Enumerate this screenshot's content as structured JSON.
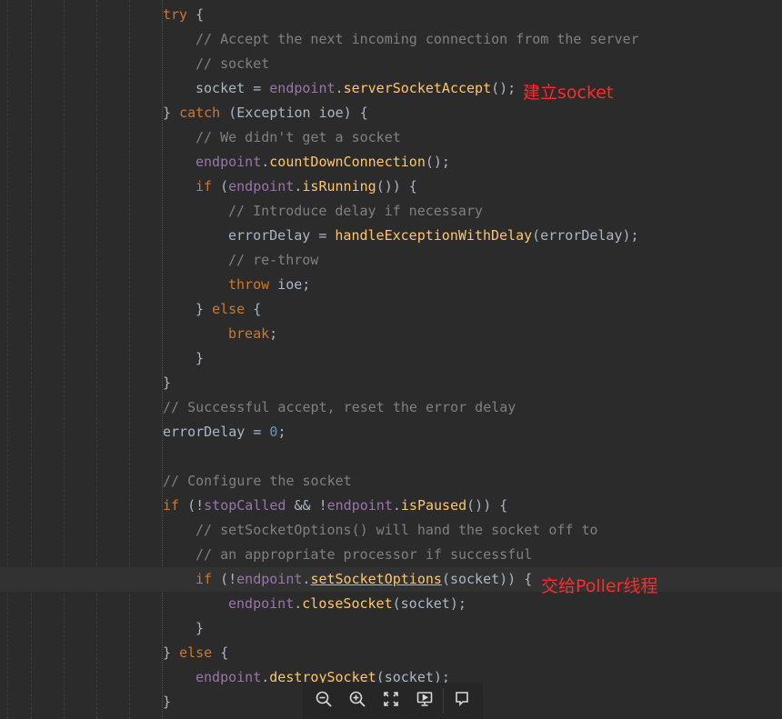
{
  "code_lines": [
    {
      "indent": 0,
      "segments": [
        {
          "cls": "kw",
          "t": "try"
        },
        {
          "cls": "plain",
          "t": " {"
        }
      ]
    },
    {
      "indent": 1,
      "segments": [
        {
          "cls": "cm",
          "t": "// Accept the next incoming connection from the server"
        }
      ]
    },
    {
      "indent": 1,
      "segments": [
        {
          "cls": "cm",
          "t": "// socket"
        }
      ]
    },
    {
      "indent": 1,
      "segments": [
        {
          "cls": "plain",
          "t": "socket = "
        },
        {
          "cls": "fld",
          "t": "endpoint"
        },
        {
          "cls": "plain",
          "t": "."
        },
        {
          "cls": "mth",
          "t": "serverSocketAccept"
        },
        {
          "cls": "plain",
          "t": "();"
        }
      ]
    },
    {
      "indent": 0,
      "segments": [
        {
          "cls": "plain",
          "t": "} "
        },
        {
          "cls": "kw",
          "t": "catch"
        },
        {
          "cls": "plain",
          "t": " (Exception ioe) {"
        }
      ]
    },
    {
      "indent": 1,
      "segments": [
        {
          "cls": "cm",
          "t": "// We didn't get a socket"
        }
      ]
    },
    {
      "indent": 1,
      "segments": [
        {
          "cls": "fld",
          "t": "endpoint"
        },
        {
          "cls": "plain",
          "t": "."
        },
        {
          "cls": "mth",
          "t": "countDownConnection"
        },
        {
          "cls": "plain",
          "t": "();"
        }
      ]
    },
    {
      "indent": 1,
      "segments": [
        {
          "cls": "kw",
          "t": "if"
        },
        {
          "cls": "plain",
          "t": " ("
        },
        {
          "cls": "fld",
          "t": "endpoint"
        },
        {
          "cls": "plain",
          "t": "."
        },
        {
          "cls": "mth",
          "t": "isRunning"
        },
        {
          "cls": "plain",
          "t": "()) {"
        }
      ]
    },
    {
      "indent": 2,
      "segments": [
        {
          "cls": "cm",
          "t": "// Introduce delay if necessary"
        }
      ]
    },
    {
      "indent": 2,
      "segments": [
        {
          "cls": "plain",
          "t": "errorDelay = "
        },
        {
          "cls": "mth",
          "t": "handleExceptionWithDelay"
        },
        {
          "cls": "plain",
          "t": "(errorDelay);"
        }
      ]
    },
    {
      "indent": 2,
      "segments": [
        {
          "cls": "cm",
          "t": "// re-throw"
        }
      ]
    },
    {
      "indent": 2,
      "segments": [
        {
          "cls": "kw",
          "t": "throw"
        },
        {
          "cls": "plain",
          "t": " ioe;"
        }
      ]
    },
    {
      "indent": 1,
      "segments": [
        {
          "cls": "plain",
          "t": "} "
        },
        {
          "cls": "kw",
          "t": "else"
        },
        {
          "cls": "plain",
          "t": " {"
        }
      ]
    },
    {
      "indent": 2,
      "segments": [
        {
          "cls": "kw",
          "t": "break"
        },
        {
          "cls": "plain",
          "t": ";"
        }
      ]
    },
    {
      "indent": 1,
      "segments": [
        {
          "cls": "plain",
          "t": "}"
        }
      ]
    },
    {
      "indent": 0,
      "segments": [
        {
          "cls": "plain",
          "t": "}"
        }
      ]
    },
    {
      "indent": 0,
      "segments": [
        {
          "cls": "cm",
          "t": "// Successful accept, reset the error delay"
        }
      ]
    },
    {
      "indent": 0,
      "segments": [
        {
          "cls": "plain",
          "t": "errorDelay = "
        },
        {
          "cls": "num",
          "t": "0"
        },
        {
          "cls": "plain",
          "t": ";"
        }
      ]
    },
    {
      "indent": 0,
      "segments": []
    },
    {
      "indent": 0,
      "segments": [
        {
          "cls": "cm",
          "t": "// Configure the socket"
        }
      ]
    },
    {
      "indent": 0,
      "segments": [
        {
          "cls": "kw",
          "t": "if"
        },
        {
          "cls": "plain",
          "t": " (!"
        },
        {
          "cls": "fld",
          "t": "stopCalled"
        },
        {
          "cls": "plain",
          "t": " && !"
        },
        {
          "cls": "fld",
          "t": "endpoint"
        },
        {
          "cls": "plain",
          "t": "."
        },
        {
          "cls": "mth",
          "t": "isPaused"
        },
        {
          "cls": "plain",
          "t": "()) {"
        }
      ]
    },
    {
      "indent": 1,
      "segments": [
        {
          "cls": "cm",
          "t": "// setSocketOptions() will hand the socket off to"
        }
      ]
    },
    {
      "indent": 1,
      "segments": [
        {
          "cls": "cm",
          "t": "// an appropriate processor if successful"
        }
      ]
    },
    {
      "indent": 1,
      "highlight": true,
      "segments": [
        {
          "cls": "kw",
          "t": "if"
        },
        {
          "cls": "plain",
          "t": " (!"
        },
        {
          "cls": "fld",
          "t": "endpoint"
        },
        {
          "cls": "plain",
          "t": "."
        },
        {
          "cls": "mth ul",
          "t": "setSocketOptions"
        },
        {
          "cls": "plain",
          "t": "(socket)) {"
        }
      ]
    },
    {
      "indent": 2,
      "segments": [
        {
          "cls": "fld",
          "t": "endpoint"
        },
        {
          "cls": "plain",
          "t": "."
        },
        {
          "cls": "mth",
          "t": "closeSocket"
        },
        {
          "cls": "plain",
          "t": "(socket);"
        }
      ]
    },
    {
      "indent": 1,
      "segments": [
        {
          "cls": "plain",
          "t": "}"
        }
      ]
    },
    {
      "indent": 0,
      "segments": [
        {
          "cls": "plain",
          "t": "} "
        },
        {
          "cls": "kw",
          "t": "else"
        },
        {
          "cls": "plain",
          "t": " {"
        }
      ]
    },
    {
      "indent": 1,
      "segments": [
        {
          "cls": "fld",
          "t": "endpoint"
        },
        {
          "cls": "plain",
          "t": "."
        },
        {
          "cls": "mth",
          "t": "destroySocket"
        },
        {
          "cls": "plain",
          "t": "(socket);"
        }
      ]
    },
    {
      "indent": 0,
      "segments": [
        {
          "cls": "plain",
          "t": "}"
        }
      ]
    }
  ],
  "annotations": {
    "socket_note": "建立socket",
    "poller_note": "交给Poller线程"
  },
  "toolbar": {
    "buttons": [
      {
        "name": "zoom-out-icon"
      },
      {
        "name": "zoom-in-icon"
      },
      {
        "name": "fullscreen-icon"
      },
      {
        "name": "slideshow-icon"
      },
      {
        "name": "comment-icon"
      }
    ]
  },
  "colors": {
    "background": "#2b2b2b",
    "keyword": "#cc7832",
    "comment": "#808080",
    "field": "#9876aa",
    "method": "#ffc66d",
    "number": "#6897bb",
    "text": "#a9b7c6",
    "annotation": "#ff2a2a"
  }
}
